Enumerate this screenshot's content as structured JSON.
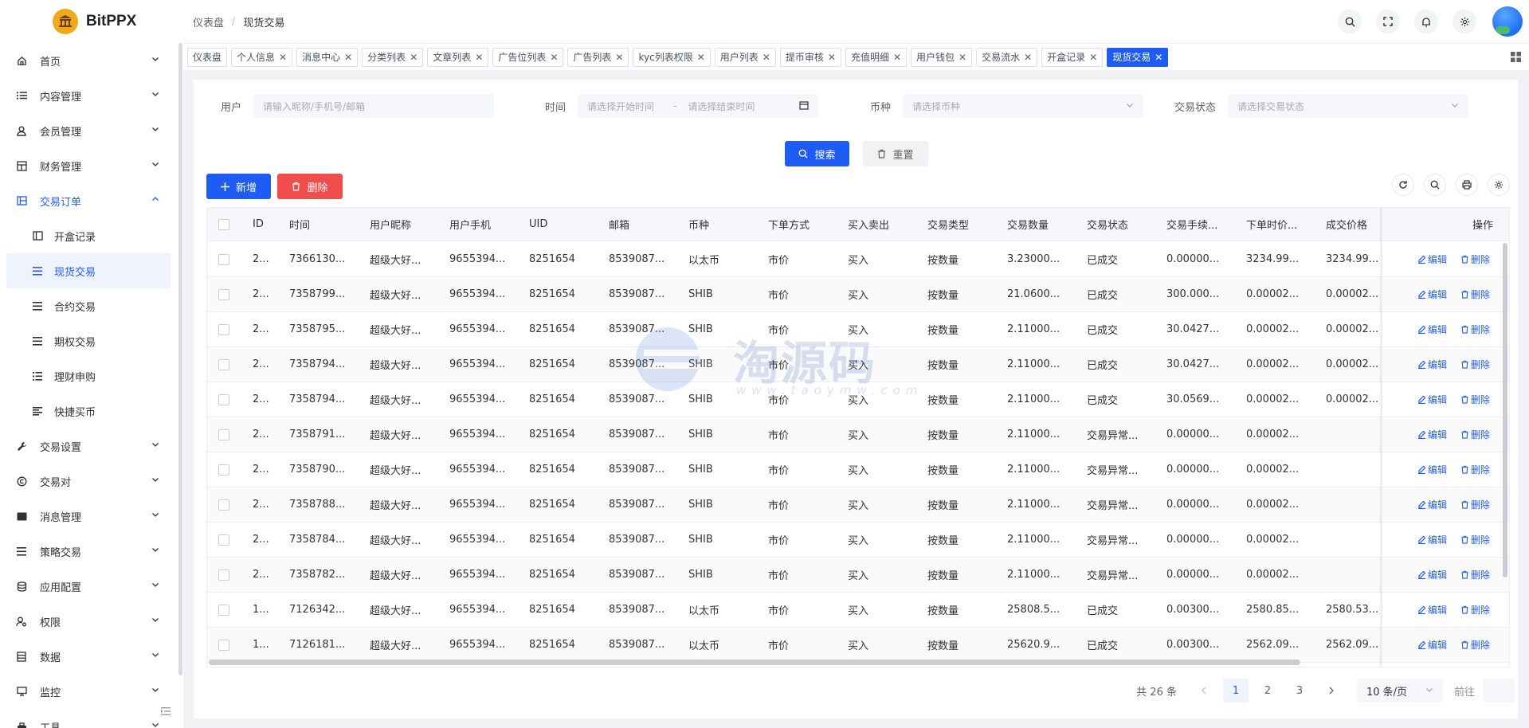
{
  "brand": {
    "name": "BitPPX",
    "logo_icon": "bank-icon"
  },
  "breadcrumb": {
    "home": "仪表盘",
    "separator": "/",
    "current": "现货交易"
  },
  "header_icons": [
    "search-icon",
    "fullscreen-icon",
    "bell-icon",
    "gear-icon"
  ],
  "sidebar": {
    "items": [
      {
        "label": "首页",
        "icon": "home-icon",
        "expandable": true
      },
      {
        "label": "内容管理",
        "icon": "list-icon",
        "expandable": true
      },
      {
        "label": "会员管理",
        "icon": "user-icon",
        "expandable": true
      },
      {
        "label": "财务管理",
        "icon": "table-icon",
        "expandable": true
      },
      {
        "label": "交易订单",
        "icon": "layout-icon",
        "expandable": true,
        "open": true,
        "children": [
          {
            "label": "开盒记录",
            "icon": "panel-icon"
          },
          {
            "label": "现货交易",
            "icon": "menu-icon",
            "active": true
          },
          {
            "label": "合约交易",
            "icon": "menu-icon"
          },
          {
            "label": "期权交易",
            "icon": "menu-icon"
          },
          {
            "label": "理财申购",
            "icon": "list-icon"
          },
          {
            "label": "快捷买币",
            "icon": "align-icon"
          }
        ]
      },
      {
        "label": "交易设置",
        "icon": "wrench-icon",
        "expandable": true
      },
      {
        "label": "交易对",
        "icon": "copyright-icon",
        "expandable": true
      },
      {
        "label": "消息管理",
        "icon": "message-icon",
        "expandable": true
      },
      {
        "label": "策略交易",
        "icon": "menu-icon",
        "expandable": true
      },
      {
        "label": "应用配置",
        "icon": "stack-icon",
        "expandable": true
      },
      {
        "label": "权限",
        "icon": "user-gear-icon",
        "expandable": true
      },
      {
        "label": "数据",
        "icon": "database-icon",
        "expandable": true
      },
      {
        "label": "监控",
        "icon": "monitor-icon",
        "expandable": true
      },
      {
        "label": "工具",
        "icon": "tool-icon",
        "expandable": true
      }
    ]
  },
  "tabs": [
    {
      "label": "仪表盘",
      "closable": false
    },
    {
      "label": "个人信息",
      "closable": true
    },
    {
      "label": "消息中心",
      "closable": true
    },
    {
      "label": "分类列表",
      "closable": true
    },
    {
      "label": "文章列表",
      "closable": true
    },
    {
      "label": "广告位列表",
      "closable": true
    },
    {
      "label": "广告列表",
      "closable": true
    },
    {
      "label": "kyc列表权限",
      "closable": true
    },
    {
      "label": "用户列表",
      "closable": true
    },
    {
      "label": "提币审核",
      "closable": true
    },
    {
      "label": "充值明细",
      "closable": true
    },
    {
      "label": "用户钱包",
      "closable": true
    },
    {
      "label": "交易流水",
      "closable": true
    },
    {
      "label": "开盒记录",
      "closable": true
    },
    {
      "label": "现货交易",
      "closable": true,
      "active": true
    }
  ],
  "tab_close_glyph": "✕",
  "filters": {
    "user_label": "用户",
    "user_placeholder": "请输入昵称/手机号/邮箱",
    "time_label": "时间",
    "time_start_placeholder": "请选择开始时间",
    "time_sep": "-",
    "time_end_placeholder": "请选择结束时间",
    "coin_label": "币种",
    "coin_placeholder": "请选择币种",
    "status_label": "交易状态",
    "status_placeholder": "请选择交易状态"
  },
  "actions": {
    "search": "搜索",
    "reset": "重置",
    "add": "新增",
    "delete": "删除"
  },
  "table": {
    "columns": [
      "ID",
      "时间",
      "用户昵称",
      "用户手机",
      "UID",
      "邮箱",
      "币种",
      "下单方式",
      "买入卖出",
      "交易类型",
      "交易数量",
      "交易状态",
      "交易手续...",
      "下单时价...",
      "成交价格"
    ],
    "op_header": "操作",
    "edit_label": "编辑",
    "delete_label": "删除",
    "rows": [
      [
        "2...",
        "7366130...",
        "超级大好...",
        "9655394...",
        "8251654",
        "8539087...",
        "以太币",
        "市价",
        "买入",
        "按数量",
        "3.23000...",
        "已成交",
        "0.00000...",
        "3234.99...",
        "3234.99..."
      ],
      [
        "2...",
        "7358799...",
        "超级大好...",
        "9655394...",
        "8251654",
        "8539087...",
        "SHIB",
        "市价",
        "买入",
        "按数量",
        "21.0600...",
        "已成交",
        "300.000...",
        "0.00002...",
        "0.00002..."
      ],
      [
        "2...",
        "7358795...",
        "超级大好...",
        "9655394...",
        "8251654",
        "8539087...",
        "SHIB",
        "市价",
        "买入",
        "按数量",
        "2.11000...",
        "已成交",
        "30.0427...",
        "0.00002...",
        "0.00002..."
      ],
      [
        "2...",
        "7358794...",
        "超级大好...",
        "9655394...",
        "8251654",
        "8539087...",
        "SHIB",
        "市价",
        "买入",
        "按数量",
        "2.11000...",
        "已成交",
        "30.0427...",
        "0.00002...",
        "0.00002..."
      ],
      [
        "2...",
        "7358794...",
        "超级大好...",
        "9655394...",
        "8251654",
        "8539087...",
        "SHIB",
        "市价",
        "买入",
        "按数量",
        "2.11000...",
        "已成交",
        "30.0569...",
        "0.00002...",
        "0.00002..."
      ],
      [
        "2...",
        "7358791...",
        "超级大好...",
        "9655394...",
        "8251654",
        "8539087...",
        "SHIB",
        "市价",
        "买入",
        "按数量",
        "2.11000...",
        "交易异常...",
        "0.00000...",
        "0.00002...",
        ""
      ],
      [
        "2...",
        "7358790...",
        "超级大好...",
        "9655394...",
        "8251654",
        "8539087...",
        "SHIB",
        "市价",
        "买入",
        "按数量",
        "2.11000...",
        "交易异常...",
        "0.00000...",
        "0.00002...",
        ""
      ],
      [
        "2...",
        "7358788...",
        "超级大好...",
        "9655394...",
        "8251654",
        "8539087...",
        "SHIB",
        "市价",
        "买入",
        "按数量",
        "2.11000...",
        "交易异常...",
        "0.00000...",
        "0.00002...",
        ""
      ],
      [
        "2...",
        "7358784...",
        "超级大好...",
        "9655394...",
        "8251654",
        "8539087...",
        "SHIB",
        "市价",
        "买入",
        "按数量",
        "2.11000...",
        "交易异常...",
        "0.00000...",
        "0.00002...",
        ""
      ],
      [
        "2...",
        "7358782...",
        "超级大好...",
        "9655394...",
        "8251654",
        "8539087...",
        "SHIB",
        "市价",
        "买入",
        "按数量",
        "2.11000...",
        "交易异常...",
        "0.00000...",
        "0.00002...",
        ""
      ],
      [
        "1...",
        "7126342...",
        "超级大好...",
        "9655394...",
        "8251654",
        "8539087...",
        "以太币",
        "市价",
        "买入",
        "按数量",
        "25808.5...",
        "已成交",
        "0.00300...",
        "2580.85...",
        "2580.53..."
      ],
      [
        "1...",
        "7126181...",
        "超级大好...",
        "9655394...",
        "8251654",
        "8539087...",
        "以太币",
        "市价",
        "买入",
        "按数量",
        "25620.9...",
        "已成交",
        "0.00300...",
        "2562.09...",
        "2562.09..."
      ]
    ]
  },
  "pagination": {
    "total": "共 26 条",
    "pages": [
      "1",
      "2",
      "3"
    ],
    "current": "1",
    "page_size": "10 条/页",
    "jump_label": "前往"
  },
  "watermark": {
    "text": "淘源码",
    "url": "www.taoymw.com"
  },
  "colors": {
    "primary": "#1f5cf5",
    "danger": "#f24d4d",
    "logo": "#f0a91a"
  }
}
